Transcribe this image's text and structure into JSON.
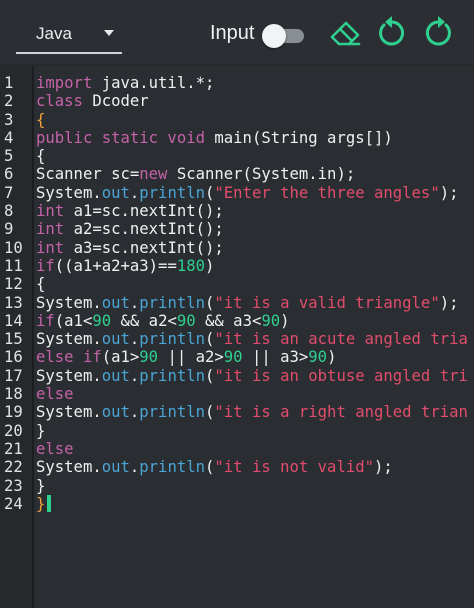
{
  "toolbar": {
    "language": "Java",
    "input_label": "Input",
    "input_toggle_on": false
  },
  "editor": {
    "line_numbers": [
      "1",
      "2",
      "3",
      "4",
      "5",
      "6",
      "7",
      "8",
      "9",
      "10",
      "11",
      "12",
      "13",
      "14",
      "15",
      "16",
      "17",
      "18",
      "19",
      "20",
      "21",
      "22",
      "23",
      "24"
    ],
    "lines": [
      [
        {
          "t": "kw",
          "v": "import "
        },
        {
          "t": "tp",
          "v": "java.util.*;"
        }
      ],
      [
        {
          "t": "kw",
          "v": "class "
        },
        {
          "t": "tp",
          "v": "Dcoder"
        }
      ],
      [
        {
          "t": "brace",
          "v": "{"
        }
      ],
      [
        {
          "t": "kw",
          "v": "public static void "
        },
        {
          "t": "tp",
          "v": "main(String args[])"
        }
      ],
      [
        {
          "t": "op",
          "v": "{"
        }
      ],
      [
        {
          "t": "tp",
          "v": "Scanner sc="
        },
        {
          "t": "kw",
          "v": "new "
        },
        {
          "t": "tp",
          "v": "Scanner(System.in);"
        }
      ],
      [
        {
          "t": "tp",
          "v": "System."
        },
        {
          "t": "fn",
          "v": "out"
        },
        {
          "t": "tp",
          "v": "."
        },
        {
          "t": "fn",
          "v": "println"
        },
        {
          "t": "tp",
          "v": "("
        },
        {
          "t": "str",
          "v": "\"Enter the three angles\""
        },
        {
          "t": "tp",
          "v": ");"
        }
      ],
      [
        {
          "t": "kw",
          "v": "int "
        },
        {
          "t": "tp",
          "v": "a1=sc.nextInt();"
        }
      ],
      [
        {
          "t": "kw",
          "v": "int "
        },
        {
          "t": "tp",
          "v": "a2=sc.nextInt();"
        }
      ],
      [
        {
          "t": "kw",
          "v": "int "
        },
        {
          "t": "tp",
          "v": "a3=sc.nextInt();"
        }
      ],
      [
        {
          "t": "kw",
          "v": "if"
        },
        {
          "t": "tp",
          "v": "((a1+a2+a3)=="
        },
        {
          "t": "num",
          "v": "180"
        },
        {
          "t": "tp",
          "v": ")"
        }
      ],
      [
        {
          "t": "op",
          "v": "{"
        }
      ],
      [
        {
          "t": "tp",
          "v": "System."
        },
        {
          "t": "fn",
          "v": "out"
        },
        {
          "t": "tp",
          "v": "."
        },
        {
          "t": "fn",
          "v": "println"
        },
        {
          "t": "tp",
          "v": "("
        },
        {
          "t": "str",
          "v": "\"it is a valid triangle\""
        },
        {
          "t": "tp",
          "v": ");"
        }
      ],
      [
        {
          "t": "kw",
          "v": "if"
        },
        {
          "t": "tp",
          "v": "(a1<"
        },
        {
          "t": "num",
          "v": "90"
        },
        {
          "t": "tp",
          "v": " && a2<"
        },
        {
          "t": "num",
          "v": "90"
        },
        {
          "t": "tp",
          "v": " && a3<"
        },
        {
          "t": "num",
          "v": "90"
        },
        {
          "t": "tp",
          "v": ")"
        }
      ],
      [
        {
          "t": "tp",
          "v": "System."
        },
        {
          "t": "fn",
          "v": "out"
        },
        {
          "t": "tp",
          "v": "."
        },
        {
          "t": "fn",
          "v": "println"
        },
        {
          "t": "tp",
          "v": "("
        },
        {
          "t": "str",
          "v": "\"it is an acute angled tria"
        }
      ],
      [
        {
          "t": "kw",
          "v": "else if"
        },
        {
          "t": "tp",
          "v": "(a1>"
        },
        {
          "t": "num",
          "v": "90"
        },
        {
          "t": "tp",
          "v": " || a2>"
        },
        {
          "t": "num",
          "v": "90"
        },
        {
          "t": "tp",
          "v": " || a3>"
        },
        {
          "t": "num",
          "v": "90"
        },
        {
          "t": "tp",
          "v": ")"
        }
      ],
      [
        {
          "t": "tp",
          "v": "System."
        },
        {
          "t": "fn",
          "v": "out"
        },
        {
          "t": "tp",
          "v": "."
        },
        {
          "t": "fn",
          "v": "println"
        },
        {
          "t": "tp",
          "v": "("
        },
        {
          "t": "str",
          "v": "\"it is an obtuse angled tri"
        }
      ],
      [
        {
          "t": "kw",
          "v": "else"
        }
      ],
      [
        {
          "t": "tp",
          "v": "System."
        },
        {
          "t": "fn",
          "v": "out"
        },
        {
          "t": "tp",
          "v": "."
        },
        {
          "t": "fn",
          "v": "println"
        },
        {
          "t": "tp",
          "v": "("
        },
        {
          "t": "str",
          "v": "\"it is a right angled trian"
        }
      ],
      [
        {
          "t": "op",
          "v": "}"
        }
      ],
      [
        {
          "t": "kw",
          "v": "else"
        }
      ],
      [
        {
          "t": "tp",
          "v": "System."
        },
        {
          "t": "fn",
          "v": "out"
        },
        {
          "t": "tp",
          "v": "."
        },
        {
          "t": "fn",
          "v": "println"
        },
        {
          "t": "tp",
          "v": "("
        },
        {
          "t": "str",
          "v": "\"it is not valid\""
        },
        {
          "t": "tp",
          "v": ");"
        }
      ],
      [
        {
          "t": "op",
          "v": "}"
        }
      ],
      [
        {
          "t": "brace",
          "v": "}"
        }
      ]
    ]
  },
  "colors": {
    "accent": "#2fd08f",
    "keyword": "#c463a8",
    "string": "#e24d6c",
    "method": "#4aa5d4",
    "brace": "#f2a33a"
  },
  "icons": {
    "eraser": "eraser-icon",
    "undo": "undo-icon",
    "redo": "redo-icon"
  }
}
